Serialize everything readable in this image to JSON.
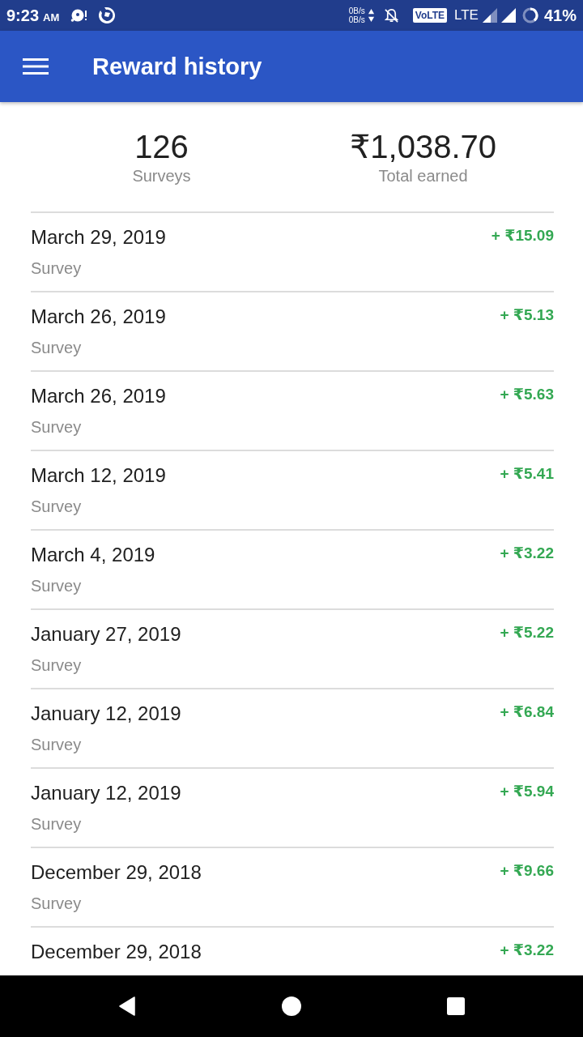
{
  "status_bar": {
    "time": "9:23",
    "am_pm": "AM",
    "net_up": "0B/s",
    "net_down": "0B/s",
    "volte": "VoLTE",
    "network": "LTE",
    "battery": "41%"
  },
  "app_bar": {
    "title": "Reward history"
  },
  "summary": [
    {
      "value": "126",
      "label": "Surveys"
    },
    {
      "value": "₹1,038.70",
      "label": "Total earned"
    }
  ],
  "rewards": [
    {
      "date": "March 29, 2019",
      "type": "Survey",
      "amount": "+ ₹15.09"
    },
    {
      "date": "March 26, 2019",
      "type": "Survey",
      "amount": "+ ₹5.13"
    },
    {
      "date": "March 26, 2019",
      "type": "Survey",
      "amount": "+ ₹5.63"
    },
    {
      "date": "March 12, 2019",
      "type": "Survey",
      "amount": "+ ₹5.41"
    },
    {
      "date": "March 4, 2019",
      "type": "Survey",
      "amount": "+ ₹3.22"
    },
    {
      "date": "January 27, 2019",
      "type": "Survey",
      "amount": "+ ₹5.22"
    },
    {
      "date": "January 12, 2019",
      "type": "Survey",
      "amount": "+ ₹6.84"
    },
    {
      "date": "January 12, 2019",
      "type": "Survey",
      "amount": "+ ₹5.94"
    },
    {
      "date": "December 29, 2018",
      "type": "Survey",
      "amount": "+ ₹9.66"
    },
    {
      "date": "December 29, 2018",
      "amount": "+ ₹3.22"
    }
  ]
}
